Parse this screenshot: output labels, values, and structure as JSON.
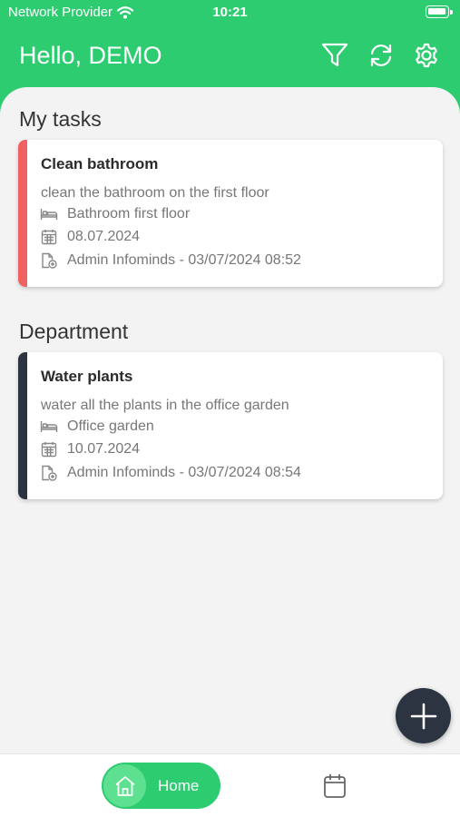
{
  "status_bar": {
    "carrier": "Network Provider",
    "time": "10:21"
  },
  "header": {
    "greeting": "Hello, DEMO"
  },
  "sections": {
    "my_tasks": {
      "title": "My tasks",
      "task": {
        "title": "Clean bathroom",
        "description": "clean the bathroom on the first floor",
        "location": "Bathroom first floor",
        "date": "08.07.2024",
        "created": "Admin Infominds - 03/07/2024 08:52",
        "accent_color": "#f06262"
      }
    },
    "department": {
      "title": "Department",
      "task": {
        "title": "Water plants",
        "description": "water all the plants in the office garden",
        "location": "Office garden",
        "date": "10.07.2024",
        "created": "Admin Infominds - 03/07/2024 08:54",
        "accent_color": "#2b3440"
      }
    }
  },
  "bottom_nav": {
    "home_label": "Home"
  },
  "colors": {
    "brand": "#2ecc71",
    "fab": "#2b3440",
    "background": "#f3f3f3"
  }
}
